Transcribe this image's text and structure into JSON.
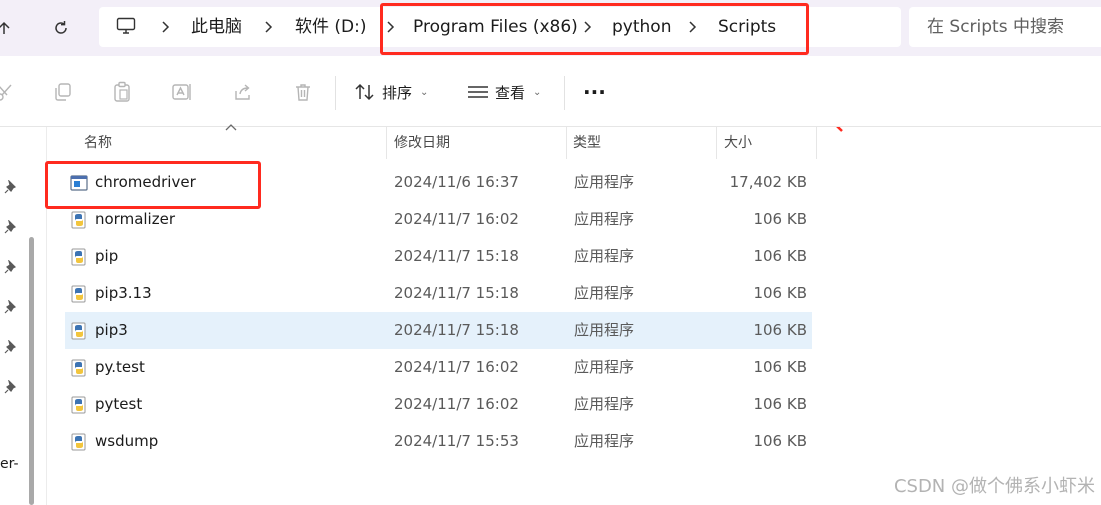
{
  "address": {
    "segments": [
      "此电脑",
      "软件 (D:)",
      "Program Files (x86)",
      "python",
      "Scripts"
    ]
  },
  "search": {
    "placeholder": "在 Scripts 中搜索"
  },
  "commandbar": {
    "sort_label": "排序",
    "view_label": "查看",
    "more_label": "···"
  },
  "columns": {
    "name": "名称",
    "date": "修改日期",
    "type": "类型",
    "size": "大小"
  },
  "files": [
    {
      "name": "chromedriver",
      "date": "2024/11/6 16:37",
      "type": "应用程序",
      "size": "17,402 KB",
      "icon": "exe-icon"
    },
    {
      "name": "normalizer",
      "date": "2024/11/7 16:02",
      "type": "应用程序",
      "size": "106 KB",
      "icon": "python-icon"
    },
    {
      "name": "pip",
      "date": "2024/11/7 15:18",
      "type": "应用程序",
      "size": "106 KB",
      "icon": "python-icon"
    },
    {
      "name": "pip3.13",
      "date": "2024/11/7 15:18",
      "type": "应用程序",
      "size": "106 KB",
      "icon": "python-icon"
    },
    {
      "name": "pip3",
      "date": "2024/11/7 15:18",
      "type": "应用程序",
      "size": "106 KB",
      "icon": "python-icon",
      "selected": true
    },
    {
      "name": "py.test",
      "date": "2024/11/7 16:02",
      "type": "应用程序",
      "size": "106 KB",
      "icon": "python-icon"
    },
    {
      "name": "pytest",
      "date": "2024/11/7 16:02",
      "type": "应用程序",
      "size": "106 KB",
      "icon": "python-icon"
    },
    {
      "name": "wsdump",
      "date": "2024/11/7 15:53",
      "type": "应用程序",
      "size": "106 KB",
      "icon": "python-icon"
    }
  ],
  "navpane": {
    "partial_text": "er-"
  },
  "watermark": "CSDN @做个佛系小虾米",
  "colors": {
    "highlight_red": "#ff2a1f",
    "selection": "#e5f1fb",
    "titlebar": "#f3eff8"
  }
}
